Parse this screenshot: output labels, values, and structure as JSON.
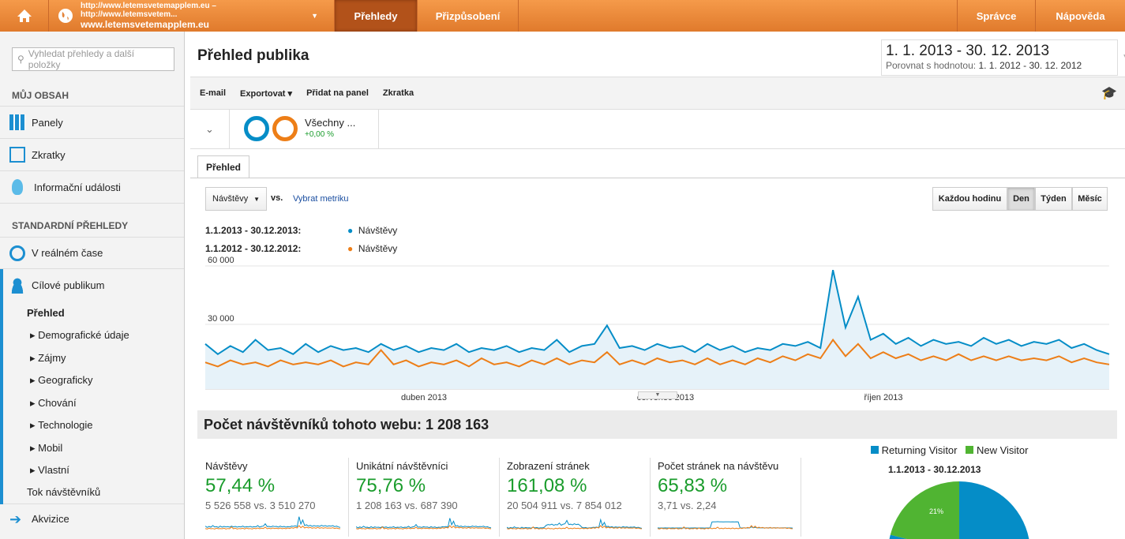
{
  "topbar": {
    "account_line1": "http://www.letemsvetemapplem.eu – http://www.letemsvetem...",
    "account_line2": "www.letemsvetemapplem.eu",
    "tabs": [
      "Přehledy",
      "Přizpůsobení"
    ],
    "right": [
      "Správce",
      "Nápověda"
    ]
  },
  "sidebar": {
    "search_placeholder": "Vyhledat přehledy a další položky",
    "my_content": "MŮJ OBSAH",
    "my_items": [
      "Panely",
      "Zkratky",
      "Informační události"
    ],
    "standard": "STANDARDNÍ PŘEHLEDY",
    "realtime": "V reálném čase",
    "audience": "Cílové publikum",
    "audience_sub": [
      "Přehled",
      "Demografické údaje",
      "Zájmy",
      "Geograficky",
      "Chování",
      "Technologie",
      "Mobil",
      "Vlastní",
      "Tok návštěvníků"
    ],
    "acquisition": "Akvizice"
  },
  "header": {
    "title": "Přehled publika",
    "date_range": "1. 1. 2013 - 30. 12. 2013",
    "compare_label": "Porovnat s hodnotou:",
    "compare_range": "1. 1. 2012 - 30. 12. 2012"
  },
  "toolbar": {
    "items": [
      "E-mail",
      "Exportovat",
      "Přidat na panel",
      "Zkratka"
    ]
  },
  "segment": {
    "name": "Všechny ...",
    "change": "+0,00 %"
  },
  "tab": "Přehled",
  "controls": {
    "metric": "Návštěvy",
    "vs": "vs.",
    "select_metric": "Vybrat metriku",
    "granularity": [
      "Každou hodinu",
      "Den",
      "Týden",
      "Měsíc"
    ],
    "active": "Den"
  },
  "colors": {
    "blue": "#058dc7",
    "orange": "#ed7e17",
    "green": "#50b432"
  },
  "chart_data": {
    "type": "line",
    "legend": [
      {
        "period": "1.1.2013 - 30.12.2013:",
        "name": "Návštěvy"
      },
      {
        "period": "1.1.2012 - 30.12.2012:",
        "name": "Návštěvy"
      }
    ],
    "y_ticks": [
      "60 000",
      "30 000"
    ],
    "ylim": [
      0,
      60000
    ],
    "x_ticks": [
      "duben 2013",
      "červenec 2013",
      "říjen 2013"
    ],
    "series": [
      {
        "name": "2013",
        "values": [
          22000,
          17000,
          21000,
          18000,
          24000,
          19000,
          20000,
          17000,
          22000,
          18000,
          21000,
          19000,
          20000,
          18000,
          22000,
          19000,
          21000,
          18000,
          20000,
          19000,
          22000,
          18000,
          20000,
          19000,
          21000,
          18000,
          20000,
          19000,
          24000,
          18000,
          21000,
          22000,
          31000,
          20000,
          21000,
          19000,
          22000,
          20000,
          21000,
          18000,
          22000,
          19000,
          21000,
          18000,
          20000,
          19000,
          22000,
          21000,
          23000,
          20000,
          58000,
          30000,
          45000,
          24000,
          27000,
          22000,
          25000,
          21000,
          24000,
          22000,
          23000,
          21000,
          25000,
          22000,
          24000,
          21000,
          23000,
          22000,
          24000,
          20000,
          22000,
          19000,
          17000
        ]
      },
      {
        "name": "2012",
        "values": [
          13000,
          11000,
          14000,
          12000,
          13000,
          11000,
          14000,
          12000,
          13000,
          12000,
          14000,
          11000,
          13000,
          12000,
          19000,
          12000,
          14000,
          11000,
          13000,
          12000,
          14000,
          11000,
          15000,
          12000,
          13000,
          11000,
          14000,
          12000,
          15000,
          12000,
          14000,
          13000,
          18000,
          12000,
          14000,
          12000,
          15000,
          13000,
          14000,
          12000,
          15000,
          12000,
          14000,
          12000,
          15000,
          13000,
          16000,
          14000,
          17000,
          15000,
          24000,
          16000,
          22000,
          15000,
          18000,
          15000,
          17000,
          14000,
          16000,
          14000,
          17000,
          14000,
          16000,
          14000,
          16000,
          14000,
          15000,
          14000,
          16000,
          13000,
          15000,
          13000,
          12000
        ]
      }
    ]
  },
  "summary": {
    "title": "Počet návštěvníků tohoto webu: 1 208 163",
    "metrics": [
      {
        "label": "Návštěvy",
        "value": "57,44 %",
        "compare": "5 526 558 vs. 3 510 270"
      },
      {
        "label": "Unikátní návštěvníci",
        "value": "75,76 %",
        "compare": "1 208 163 vs. 687 390"
      },
      {
        "label": "Zobrazení stránek",
        "value": "161,08 %",
        "compare": "20 504 911 vs. 7 854 012"
      },
      {
        "label": "Počet stránek na návštěvu",
        "value": "65,83 %",
        "compare": "3,71 vs. 2,24"
      }
    ]
  },
  "pie": {
    "legend": [
      "Returning Visitor",
      "New Visitor"
    ],
    "title": "1.1.2013 - 30.12.2013",
    "values": [
      79,
      21
    ],
    "label": "21%"
  }
}
